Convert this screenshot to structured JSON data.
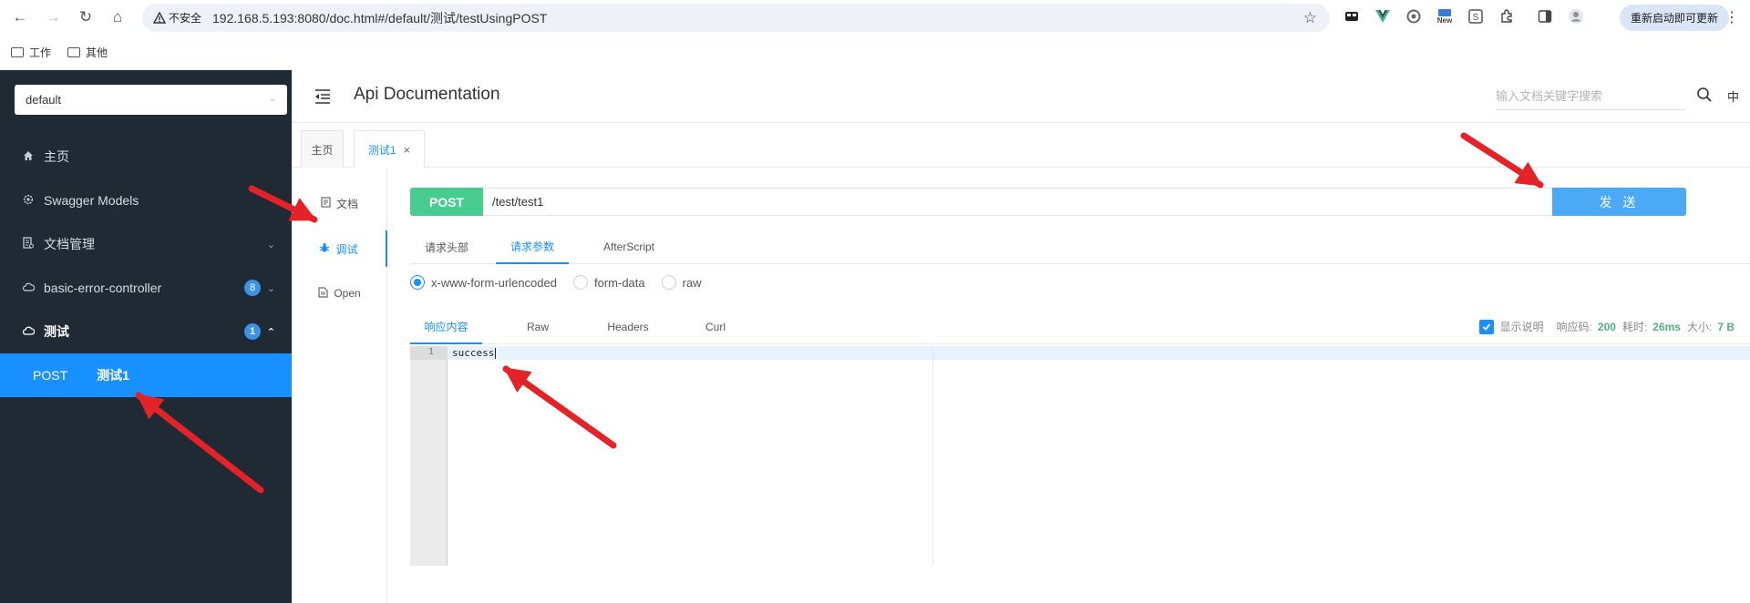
{
  "browser": {
    "security_label": "不安全",
    "url": "192.168.5.193:8080/doc.html#/default/测试/testUsingPOST",
    "update_button": "重新启动即可更新",
    "bookmarks": [
      "工作",
      "其他"
    ],
    "ext_new_label": "New"
  },
  "sidebar": {
    "group_select": "default",
    "items": [
      {
        "label": "主页",
        "icon": "home-icon"
      },
      {
        "label": "Swagger Models",
        "icon": "gear-icon"
      },
      {
        "label": "文档管理",
        "icon": "doc-icon"
      },
      {
        "label": "basic-error-controller",
        "icon": "cloud-icon",
        "badge": "8"
      },
      {
        "label": "测试",
        "icon": "cloud-icon",
        "badge": "1"
      }
    ],
    "active_item": {
      "method": "POST",
      "name": "测试1"
    }
  },
  "header": {
    "title": "Api Documentation",
    "search_placeholder": "输入文档关键字搜索",
    "lang": "中"
  },
  "tabs": [
    {
      "label": "主页"
    },
    {
      "label": "测试1",
      "closable": true
    }
  ],
  "subnav": [
    {
      "label": "文档",
      "icon": "document-icon"
    },
    {
      "label": "调试",
      "icon": "bug-icon"
    },
    {
      "label": "Open",
      "icon": "file-icon"
    }
  ],
  "request": {
    "method": "POST",
    "path": "/test/test1",
    "send_label": "发 送"
  },
  "param_tabs": [
    "请求头部",
    "请求参数",
    "AfterScript"
  ],
  "body_types": [
    "x-www-form-urlencoded",
    "form-data",
    "raw"
  ],
  "response_tabs": [
    "响应内容",
    "Raw",
    "Headers",
    "Curl"
  ],
  "response_meta": {
    "show_desc": "显示说明",
    "code_label": "响应码:",
    "code": "200",
    "time_label": "耗时:",
    "time": "26ms",
    "size_label": "大小:",
    "size": "7 B"
  },
  "editor": {
    "line_number": "1",
    "content": "success"
  },
  "colors": {
    "sidebar_bg": "#1f2a34",
    "accent": "#1890ff",
    "post_green": "#49cc90",
    "send_blue": "#4ba9f5",
    "annotation_red": "#e52228"
  }
}
